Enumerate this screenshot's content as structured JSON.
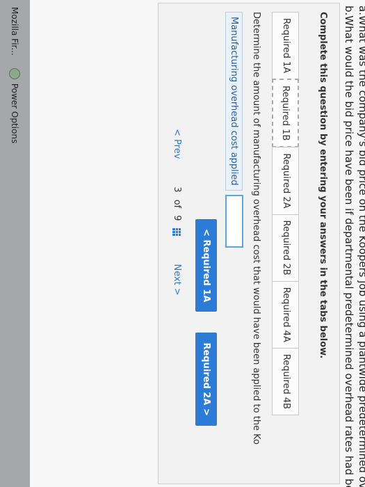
{
  "question": {
    "line_a": "a.What was the company's bid price on the Koopers job using a plantwide predetermined ov",
    "line_b": "b.What would the bid price have been if departmental predetermined overhead rates had be"
  },
  "instruction": "Complete this question by entering your answers in the tabs below.",
  "tabs": [
    {
      "label": "Required 1A"
    },
    {
      "label": "Required 1B"
    },
    {
      "label": "Required 2A"
    },
    {
      "label": "Required 2B"
    },
    {
      "label": "Required 4A"
    },
    {
      "label": "Required 4B"
    }
  ],
  "determine_text": "Determine the amount of manufacturing overhead cost that would have been applied to the Ko",
  "row_label": "Manufacturing overhead cost applied",
  "buttons": {
    "prev_label": "< Required 1A",
    "next_label": "Required 2A >"
  },
  "pager": {
    "prev": "Prev",
    "current": "3",
    "of": "of",
    "total": "9",
    "next": "Next"
  },
  "taskbar": {
    "item1": "Mozilla Fir...",
    "item2": "Power Options"
  }
}
